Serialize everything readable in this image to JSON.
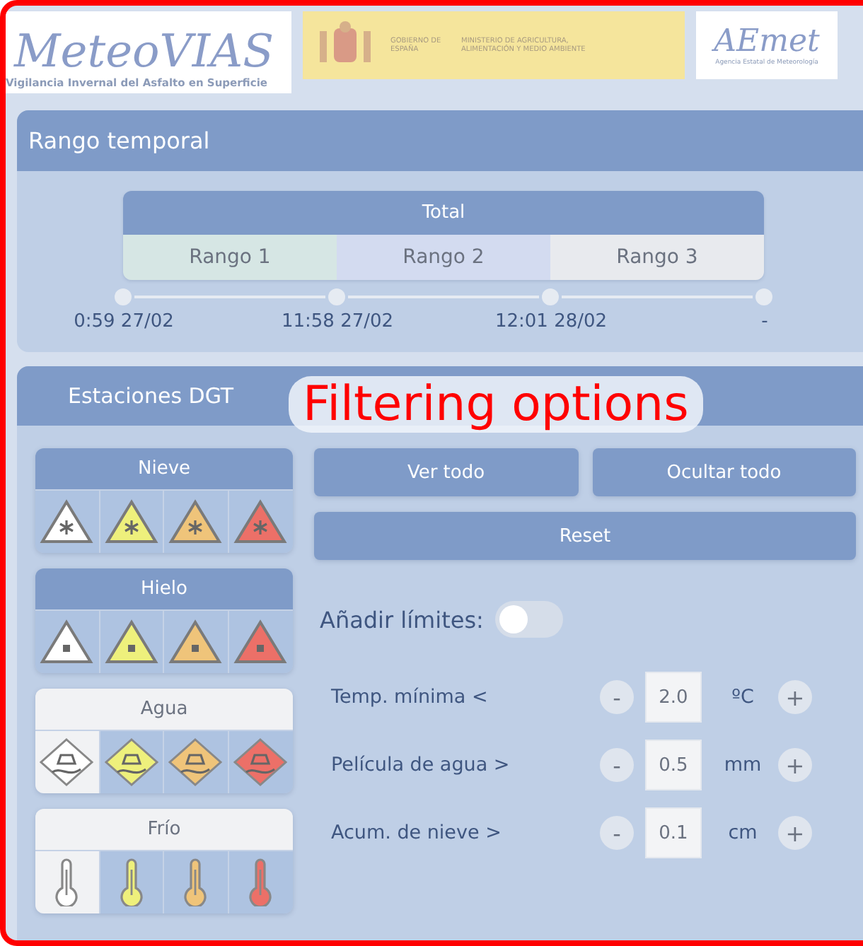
{
  "header": {
    "app_logo": {
      "title": "MeteoVIAS",
      "subtitle": "Vigilancia Invernal del Asfalto en Superficie"
    },
    "government": {
      "line_1": "GOBIERNO DE ESPAÑA",
      "line_2": "MINISTERIO DE AGRICULTURA, ALIMENTACIÓN Y MEDIO AMBIENTE"
    },
    "agency_logo": {
      "title": "AEmet",
      "subtitle": "Agencia Estatal de Meteorología"
    }
  },
  "time_range": {
    "title": "Rango temporal",
    "total": "Total",
    "ranges": [
      {
        "label": "Rango 1",
        "color": "#d6e6e4"
      },
      {
        "label": "Rango 2",
        "color": "#d3dbf0"
      },
      {
        "label": "Rango 3",
        "color": "#e8eaee"
      }
    ],
    "ticks": [
      "0:59 27/02",
      "11:58 27/02",
      "12:01 28/02",
      "-"
    ]
  },
  "stations": {
    "title": "Estaciones DGT",
    "groups": [
      {
        "kind": "snow",
        "label": "Nieve",
        "selected": true,
        "levels": [
          {
            "color": "#ffffff",
            "selected": false
          },
          {
            "color": "#eef07c",
            "selected": false
          },
          {
            "color": "#efc47a",
            "selected": false
          },
          {
            "color": "#ec7068",
            "selected": false
          }
        ]
      },
      {
        "kind": "ice",
        "label": "Hielo",
        "selected": true,
        "levels": [
          {
            "color": "#ffffff",
            "selected": false
          },
          {
            "color": "#eef07c",
            "selected": false
          },
          {
            "color": "#efc47a",
            "selected": false
          },
          {
            "color": "#ec7068",
            "selected": false
          }
        ]
      },
      {
        "kind": "water",
        "label": "Agua",
        "selected": false,
        "levels": [
          {
            "color": "#ffffff",
            "selected": true
          },
          {
            "color": "#eef07c",
            "selected": false
          },
          {
            "color": "#efc47a",
            "selected": false
          },
          {
            "color": "#ec7068",
            "selected": false
          }
        ]
      },
      {
        "kind": "cold",
        "label": "Frío",
        "selected": false,
        "levels": [
          {
            "color": "#ffffff",
            "selected": true
          },
          {
            "color": "#eef07c",
            "selected": false
          },
          {
            "color": "#efc47a",
            "selected": false
          },
          {
            "color": "#ec7068",
            "selected": false
          }
        ]
      }
    ],
    "buttons": [
      "Ver todo",
      "Ocultar todo",
      "Reset"
    ],
    "limits_toggle": {
      "label": "Añadir límites:",
      "on": false
    },
    "limits": [
      {
        "label": "Temp. mínima <",
        "minus": "-",
        "value": "2.0",
        "unit": "ºC",
        "plus": "+"
      },
      {
        "label": "Película de agua >",
        "minus": "-",
        "value": "0.5",
        "unit": "mm",
        "plus": "+"
      },
      {
        "label": "Acum. de nieve >",
        "minus": "-",
        "value": "0.1",
        "unit": "cm",
        "plus": "+"
      }
    ]
  },
  "annotation": {
    "text": "Filtering options"
  }
}
